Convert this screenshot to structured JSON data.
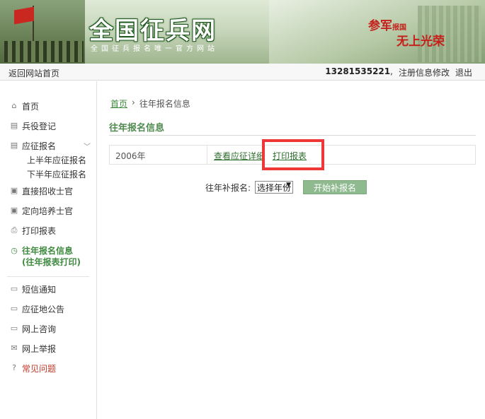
{
  "banner": {
    "title": "全国征兵网",
    "subtitle": "全国征兵报名唯一官方网站",
    "slogan_a": "参军",
    "slogan_b": "报国",
    "slogan_c": "无上",
    "slogan_d": "光荣"
  },
  "topbar": {
    "home_link": "返回网站首页",
    "phone": "13281535221",
    "separator": ",",
    "edit_info": "注册信息修改",
    "logout": "退出"
  },
  "sidebar": {
    "items": [
      {
        "label": "首页",
        "icon": "home-icon"
      },
      {
        "label": "兵役登记",
        "icon": "form-icon"
      },
      {
        "label": "应征报名",
        "icon": "form-icon"
      },
      {
        "label": "上半年应征报名"
      },
      {
        "label": "下半年应征报名"
      },
      {
        "label": "直接招收士官",
        "icon": "user-card-icon"
      },
      {
        "label": "定向培养士官",
        "icon": "user-card-icon"
      },
      {
        "label": "打印报表",
        "icon": "printer-icon"
      },
      {
        "label": "往年报名信息",
        "label2": "(往年报表打印)",
        "icon": "history-icon"
      },
      {
        "label": "短信通知",
        "icon": "chat-icon"
      },
      {
        "label": "应征地公告",
        "icon": "chat-icon"
      },
      {
        "label": "网上咨询",
        "icon": "chat-icon"
      },
      {
        "label": "网上举报",
        "icon": "mail-icon"
      },
      {
        "label": "常见问题",
        "icon": "question-icon"
      }
    ]
  },
  "main": {
    "breadcrumb_home": "首页",
    "breadcrumb_sep": "›",
    "breadcrumb_current": "往年报名信息",
    "section_title": "往年报名信息",
    "records": [
      {
        "year": "2006年",
        "detail_link": "查看应征详细",
        "print_link": "打印报表"
      }
    ],
    "makeup_label": "往年补报名:",
    "select_value": "选择年份",
    "start_button": "开始补报名"
  },
  "colors": {
    "accent_green": "#3f8a3f",
    "button_green": "#8fba8f",
    "highlight_red": "#ee3737"
  }
}
